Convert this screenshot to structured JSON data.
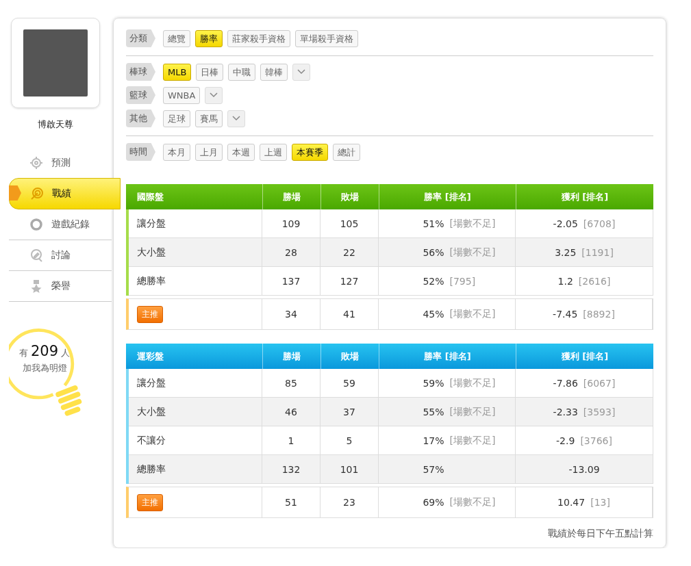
{
  "profile": {
    "name": "博啟天尊"
  },
  "nav": [
    {
      "label": "預測",
      "kind": "target",
      "selected": false
    },
    {
      "label": "戰績",
      "kind": "bullseye",
      "selected": true
    },
    {
      "label": "遊戲紀錄",
      "kind": "ring",
      "selected": false
    },
    {
      "label": "討論",
      "kind": "chat",
      "selected": false
    },
    {
      "label": "榮譽",
      "kind": "medal",
      "selected": false
    }
  ],
  "followers": {
    "prefix": "有",
    "count": "209",
    "suffix": "人",
    "caption": "加我為明燈"
  },
  "filter_sections": [
    [
      {
        "label": "分類",
        "more": false,
        "options": [
          {
            "label": "總覽",
            "selected": false
          },
          {
            "label": "勝率",
            "selected": true
          },
          {
            "label": "莊家殺手資格",
            "selected": false
          },
          {
            "label": "單場殺手資格",
            "selected": false
          }
        ]
      }
    ],
    [
      {
        "label": "棒球",
        "more": true,
        "options": [
          {
            "label": "MLB",
            "selected": true
          },
          {
            "label": "日棒",
            "selected": false
          },
          {
            "label": "中職",
            "selected": false
          },
          {
            "label": "韓棒",
            "selected": false
          }
        ]
      },
      {
        "label": "籃球",
        "more": true,
        "options": [
          {
            "label": "WNBA",
            "selected": false
          }
        ]
      },
      {
        "label": "其他",
        "more": true,
        "options": [
          {
            "label": "足球",
            "selected": false
          },
          {
            "label": "賽馬",
            "selected": false
          }
        ]
      }
    ],
    [
      {
        "label": "時間",
        "more": false,
        "options": [
          {
            "label": "本月",
            "selected": false
          },
          {
            "label": "上月",
            "selected": false
          },
          {
            "label": "本週",
            "selected": false
          },
          {
            "label": "上週",
            "selected": false
          },
          {
            "label": "本賽季",
            "selected": true
          },
          {
            "label": "總計",
            "selected": false
          }
        ]
      }
    ]
  ],
  "tables": [
    {
      "kind": "green",
      "columns": [
        "國際盤",
        "勝場",
        "敗場",
        "勝率 [排名]",
        "獲利 [排名]"
      ],
      "rows": [
        {
          "label": "讓分盤",
          "wins": "109",
          "losses": "105",
          "rate": "51%",
          "rate_rank": "[場數不足]",
          "profit": "-2.05",
          "profit_rank": "[6708]"
        },
        {
          "label": "大小盤",
          "wins": "28",
          "losses": "22",
          "rate": "56%",
          "rate_rank": "[場數不足]",
          "profit": "3.25",
          "profit_rank": "[1191]"
        },
        {
          "label": "總勝率",
          "wins": "137",
          "losses": "127",
          "rate": "52%",
          "rate_rank": "[795]",
          "profit": "1.2",
          "profit_rank": "[2616]"
        }
      ],
      "featured": {
        "badge": "主推",
        "wins": "34",
        "losses": "41",
        "rate": "45%",
        "rate_rank": "[場數不足]",
        "profit": "-7.45",
        "profit_rank": "[8892]"
      }
    },
    {
      "kind": "blue",
      "columns": [
        "運彩盤",
        "勝場",
        "敗場",
        "勝率 [排名]",
        "獲利 [排名]"
      ],
      "rows": [
        {
          "label": "讓分盤",
          "wins": "85",
          "losses": "59",
          "rate": "59%",
          "rate_rank": "[場數不足]",
          "profit": "-7.86",
          "profit_rank": "[6067]"
        },
        {
          "label": "大小盤",
          "wins": "46",
          "losses": "37",
          "rate": "55%",
          "rate_rank": "[場數不足]",
          "profit": "-2.33",
          "profit_rank": "[3593]"
        },
        {
          "label": "不讓分",
          "wins": "1",
          "losses": "5",
          "rate": "17%",
          "rate_rank": "[場數不足]",
          "profit": "-2.9",
          "profit_rank": "[3766]"
        },
        {
          "label": "總勝率",
          "wins": "132",
          "losses": "101",
          "rate": "57%",
          "profit": "-13.09"
        }
      ],
      "featured": {
        "badge": "主推",
        "wins": "51",
        "losses": "23",
        "rate": "69%",
        "rate_rank": "[場數不足]",
        "profit": "10.47",
        "profit_rank": "[13]"
      }
    }
  ],
  "footnote": "戰績於每日下午五點計算"
}
